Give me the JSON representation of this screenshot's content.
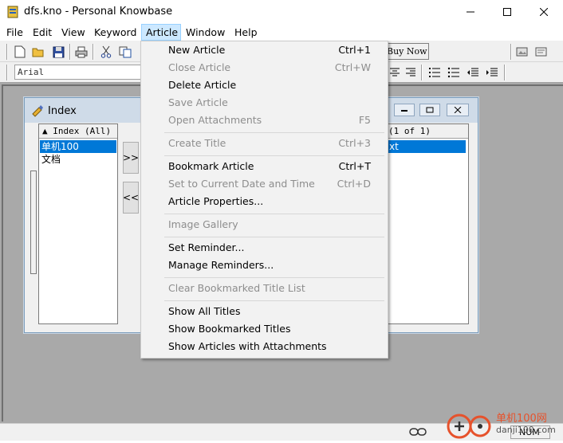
{
  "window": {
    "title": "dfs.kno - Personal Knowbase",
    "minimize": "—",
    "maximize": "☐",
    "close": "✕"
  },
  "menubar": {
    "items": [
      {
        "label": "File"
      },
      {
        "label": "Edit"
      },
      {
        "label": "View"
      },
      {
        "label": "Keyword"
      },
      {
        "label": "Article"
      },
      {
        "label": "Window"
      },
      {
        "label": "Help"
      }
    ]
  },
  "toolbar": {
    "font_name": "Arial",
    "buy_label": "Buy Now!",
    "icons": [
      "new-icon",
      "open-icon",
      "save-icon",
      "print-icon",
      "cut-icon",
      "copy-icon"
    ]
  },
  "index_window": {
    "title": "Index",
    "left_header": "▲ Index (All)",
    "left_items": [
      "单机100",
      "文档"
    ],
    "move_right": ">>",
    "move_left": "<<",
    "right_header": "(1 of 1)",
    "right_items": [
      "xt"
    ]
  },
  "article_menu": {
    "items": [
      {
        "label": "New Article",
        "shortcut": "Ctrl+1",
        "enabled": true
      },
      {
        "label": "Close Article",
        "shortcut": "Ctrl+W",
        "enabled": false
      },
      {
        "label": "Delete Article",
        "shortcut": "",
        "enabled": true
      },
      {
        "label": "Save Article",
        "shortcut": "",
        "enabled": false
      },
      {
        "label": "Open Attachments",
        "shortcut": "F5",
        "enabled": false
      },
      {
        "label": "Create Title",
        "shortcut": "Ctrl+3",
        "enabled": false
      },
      {
        "label": "Bookmark Article",
        "shortcut": "Ctrl+T",
        "enabled": true
      },
      {
        "label": "Set to Current Date and Time",
        "shortcut": "Ctrl+D",
        "enabled": false
      },
      {
        "label": "Article Properties...",
        "shortcut": "",
        "enabled": true
      },
      {
        "label": "Image Gallery",
        "shortcut": "",
        "enabled": false
      },
      {
        "label": "Set Reminder...",
        "shortcut": "",
        "enabled": true
      },
      {
        "label": "Manage Reminders...",
        "shortcut": "",
        "enabled": true
      },
      {
        "label": "Clear Bookmarked Title List",
        "shortcut": "",
        "enabled": false
      },
      {
        "label": "Show All Titles",
        "shortcut": "",
        "enabled": true
      },
      {
        "label": "Show Bookmarked Titles",
        "shortcut": "",
        "enabled": true
      },
      {
        "label": "Show Articles with Attachments",
        "shortcut": "",
        "enabled": true
      }
    ]
  },
  "statusbar": {
    "num_indicator": "NUM"
  },
  "watermark": {
    "text": "单机100网",
    "url": "danji100.com"
  },
  "colors": {
    "accent": "#0078d7",
    "menu_highlight": "#cce8ff",
    "mdi_background": "#a9a9a9",
    "disabled_text": "#8d8d8d"
  }
}
